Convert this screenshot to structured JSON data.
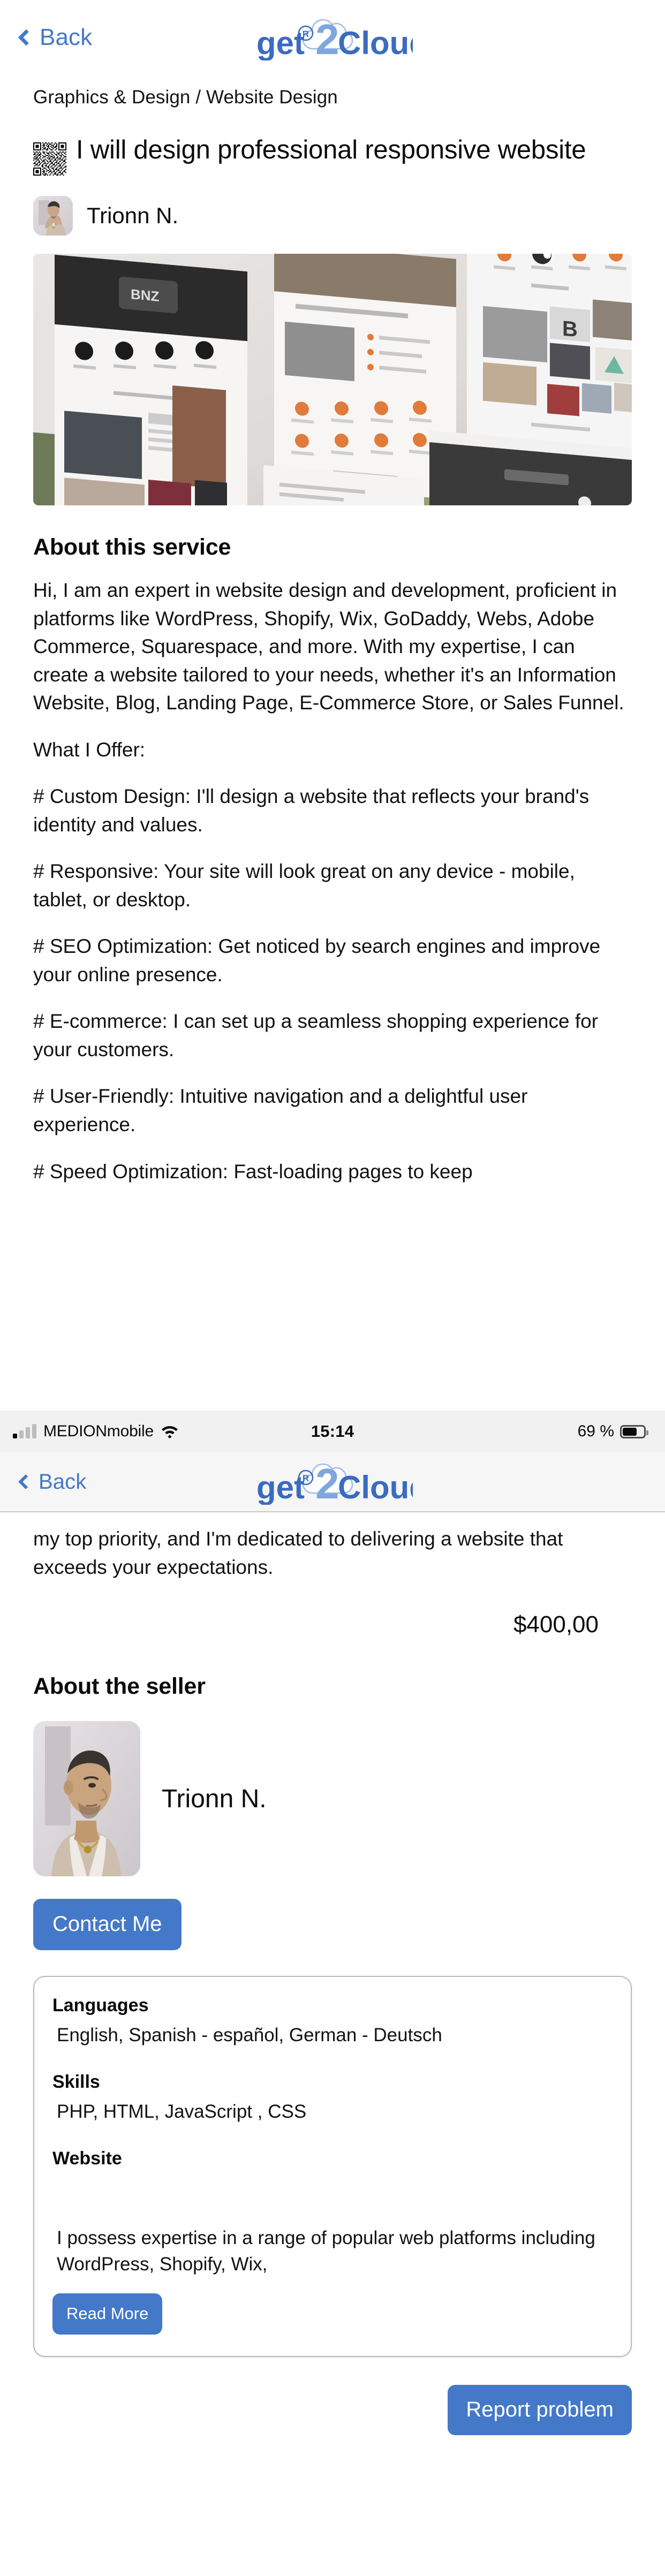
{
  "brand": {
    "logo_text_1": "get",
    "logo_registered": "®",
    "logo_digit": "2",
    "logo_text_2": "Clouds",
    "accent_blue": "#4478c8",
    "logo_cloud_blue": "#7fa6dd"
  },
  "nav": {
    "back_label": "Back",
    "back_icon": "chevron-left-icon"
  },
  "breadcrumb": "Graphics & Design / Website Design",
  "listing": {
    "qr_icon": "qr-code-icon",
    "title": "I will design professional responsive website",
    "seller_name": "Trionn  N.",
    "hero_alt": "website-design-mockups"
  },
  "about_service": {
    "heading": "About this service",
    "paragraphs": [
      "Hi, I am an expert in website design and development, proficient in platforms like WordPress, Shopify, Wix, GoDaddy, Webs, Adobe Commerce, Squarespace, and more. With my expertise, I can create a website tailored to your needs, whether it's an Information Website, Blog, Landing Page, E-Commerce Store, or Sales Funnel.",
      "What I Offer:",
      "# Custom Design: I'll design a website that reflects your brand's identity and values.",
      "# Responsive: Your site will look great on any device - mobile, tablet, or desktop.",
      "# SEO Optimization: Get noticed by search engines and improve your online presence.",
      "# E-commerce: I can set up a seamless shopping experience for your customers.",
      "# User-Friendly: Intuitive navigation and a delightful user experience.",
      "# Speed Optimization: Fast-loading pages to keep"
    ],
    "continued_paragraph": "my top priority, and I'm dedicated to delivering a website that exceeds your expectations."
  },
  "price": "$400,00",
  "about_seller": {
    "heading": "About the seller",
    "name": "Trionn  N.",
    "avatar_alt": "seller-portrait",
    "contact_label": "Contact Me"
  },
  "info_card": {
    "languages_label": "Languages",
    "languages_value": "English, Spanish - español, German - Deutsch",
    "skills_label": "Skills",
    "skills_value": " PHP, HTML, JavaScript , CSS",
    "website_label": "Website",
    "website_value": "",
    "description": "I possess expertise in a range of popular web platforms including WordPress, Shopify, Wix,",
    "read_more_label": "Read More"
  },
  "report": {
    "label": "Report problem"
  },
  "statusbar": {
    "signal_icon": "signal-bars-icon",
    "carrier": "MEDIONmobile",
    "wifi_icon": "wifi-icon",
    "time": "15:14",
    "battery_percent": "69 %",
    "battery_icon": "battery-icon",
    "battery_level": 69
  }
}
